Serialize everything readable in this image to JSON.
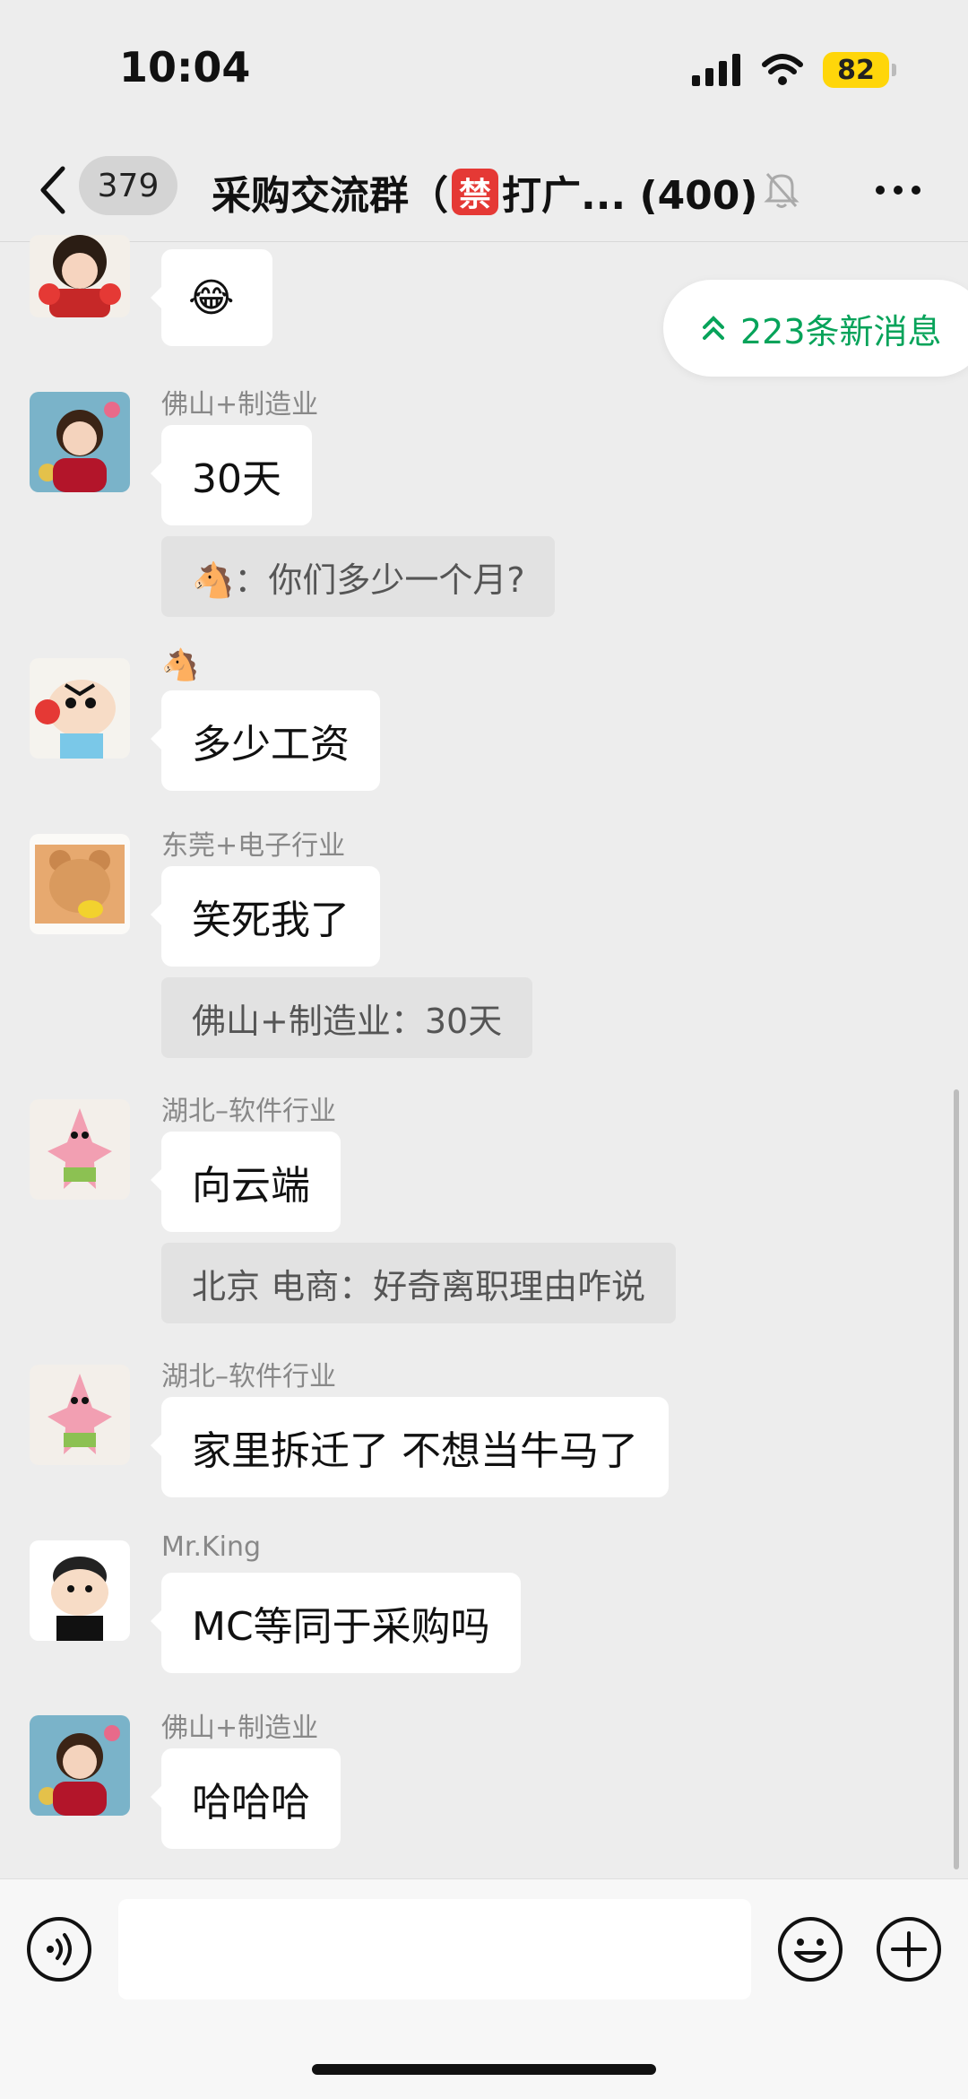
{
  "status_bar": {
    "time": "10:04",
    "battery": "82"
  },
  "nav": {
    "back_count": "379",
    "title_prefix": "采购交流群（",
    "title_badge": "禁",
    "title_suffix": "打广... (400)"
  },
  "new_messages": {
    "label": "223条新消息"
  },
  "messages": [
    {
      "sender": "",
      "text": "😂",
      "avatar_icon": "sticker-girl-avatar"
    },
    {
      "sender": "佛山+制造业",
      "text": "30天",
      "quote": "🐴：你们多少一个月?",
      "avatar_icon": "child-photo-avatar"
    },
    {
      "sender": "🐴",
      "text": "多少工资",
      "avatar_icon": "crayon-shin-chan-avatar"
    },
    {
      "sender": "东莞+电子行业",
      "text": "笑死我了",
      "quote": "佛山+制造业：30天",
      "avatar_icon": "bear-avatar"
    },
    {
      "sender": "湖北–软件行业",
      "text": "向云端",
      "quote": "北京 电商：好奇离职理由咋说",
      "avatar_icon": "patrick-star-avatar"
    },
    {
      "sender": "湖北–软件行业",
      "text": "家里拆迁了 不想当牛马了",
      "avatar_icon": "patrick-star-avatar"
    },
    {
      "sender": "Mr.King",
      "text": "MC等同于采购吗",
      "avatar_icon": "cartoon-boy-avatar"
    },
    {
      "sender": "佛山+制造业",
      "text": "哈哈哈",
      "avatar_icon": "child-photo-avatar"
    }
  ],
  "input": {
    "placeholder": ""
  },
  "colors": {
    "background": "#ededed",
    "accent_green": "#07a35a",
    "ban_red": "#e53935",
    "battery_yellow": "#ffd60a"
  }
}
